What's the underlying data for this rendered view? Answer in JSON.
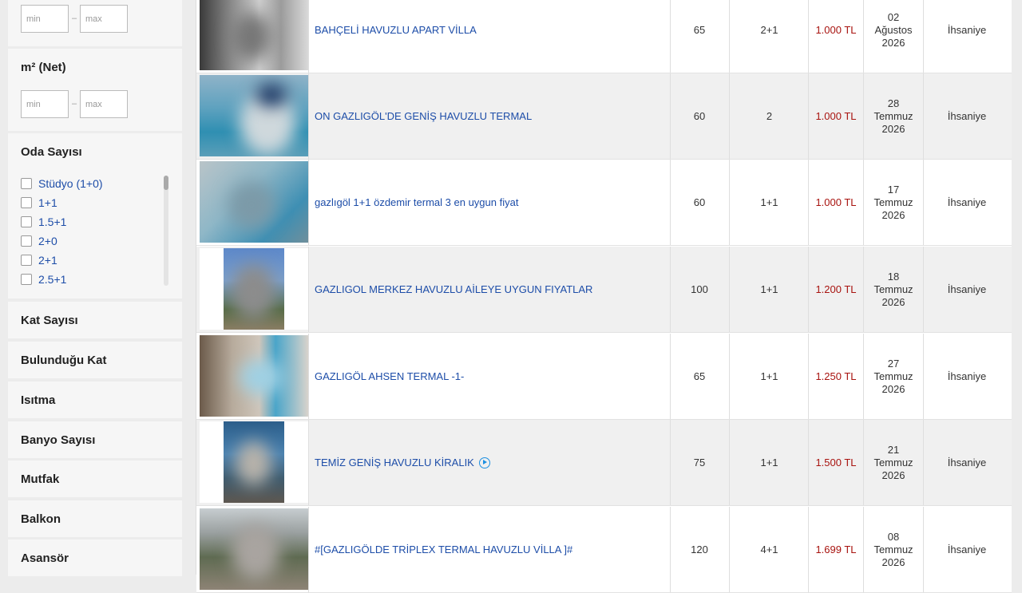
{
  "filters": {
    "top_range": {
      "min_placeholder": "min",
      "max_placeholder": "max",
      "dash": "–"
    },
    "m2_net": {
      "title": "m² (Net)",
      "min_placeholder": "min",
      "max_placeholder": "max",
      "dash": "–"
    },
    "oda_sayisi": {
      "title": "Oda Sayısı",
      "options": [
        "Stüdyo (1+0)",
        "1+1",
        "1.5+1",
        "2+0",
        "2+1",
        "2.5+1"
      ]
    },
    "collapsed": [
      "Kat Sayısı",
      "Bulunduğu Kat",
      "Isıtma",
      "Banyo Sayısı",
      "Mutfak",
      "Balkon",
      "Asansör"
    ]
  },
  "listings": [
    {
      "title": "BAHÇELİ HAVUZLU APART VİLLA",
      "m2": "65",
      "rooms": "2+1",
      "price": "1.000 TL",
      "date_day": "02",
      "date_month": "Ağustos",
      "date_year": "2026",
      "location": "İhsaniye",
      "has_video": false
    },
    {
      "title": "ON GAZLIGÖL'DE GENİŞ HAVUZLU TERMAL",
      "m2": "60",
      "rooms": "2",
      "price": "1.000 TL",
      "date_day": "28",
      "date_month": "Temmuz",
      "date_year": "2026",
      "location": "İhsaniye",
      "has_video": false
    },
    {
      "title": "gazlıgöl 1+1 özdemir termal 3 en uygun fiyat",
      "m2": "60",
      "rooms": "1+1",
      "price": "1.000 TL",
      "date_day": "17",
      "date_month": "Temmuz",
      "date_year": "2026",
      "location": "İhsaniye",
      "has_video": false
    },
    {
      "title": "GAZLIGOL MERKEZ HAVUZLU AİLEYE UYGUN FIYATLAR",
      "m2": "100",
      "rooms": "1+1",
      "price": "1.200 TL",
      "date_day": "18",
      "date_month": "Temmuz",
      "date_year": "2026",
      "location": "İhsaniye",
      "has_video": false
    },
    {
      "title": "GAZLIGÖL AHSEN TERMAL -1-",
      "m2": "65",
      "rooms": "1+1",
      "price": "1.250 TL",
      "date_day": "27",
      "date_month": "Temmuz",
      "date_year": "2026",
      "location": "İhsaniye",
      "has_video": false
    },
    {
      "title": "TEMİZ GENİŞ HAVUZLU KİRALIK",
      "m2": "75",
      "rooms": "1+1",
      "price": "1.500 TL",
      "date_day": "21",
      "date_month": "Temmuz",
      "date_year": "2026",
      "location": "İhsaniye",
      "has_video": true
    },
    {
      "title": "#[GAZLIGÖLDE TRİPLEX TERMAL HAVUZLU VİLLA ]#",
      "m2": "120",
      "rooms": "4+1",
      "price": "1.699 TL",
      "date_day": "08",
      "date_month": "Temmuz",
      "date_year": "2026",
      "location": "İhsaniye",
      "has_video": false
    }
  ],
  "colors": {
    "link": "#1d4da8",
    "price": "#a8130f",
    "video_icon": "#1d8fe0"
  },
  "icons": {
    "video": "play-circle-icon",
    "checkbox": "checkbox-icon"
  }
}
